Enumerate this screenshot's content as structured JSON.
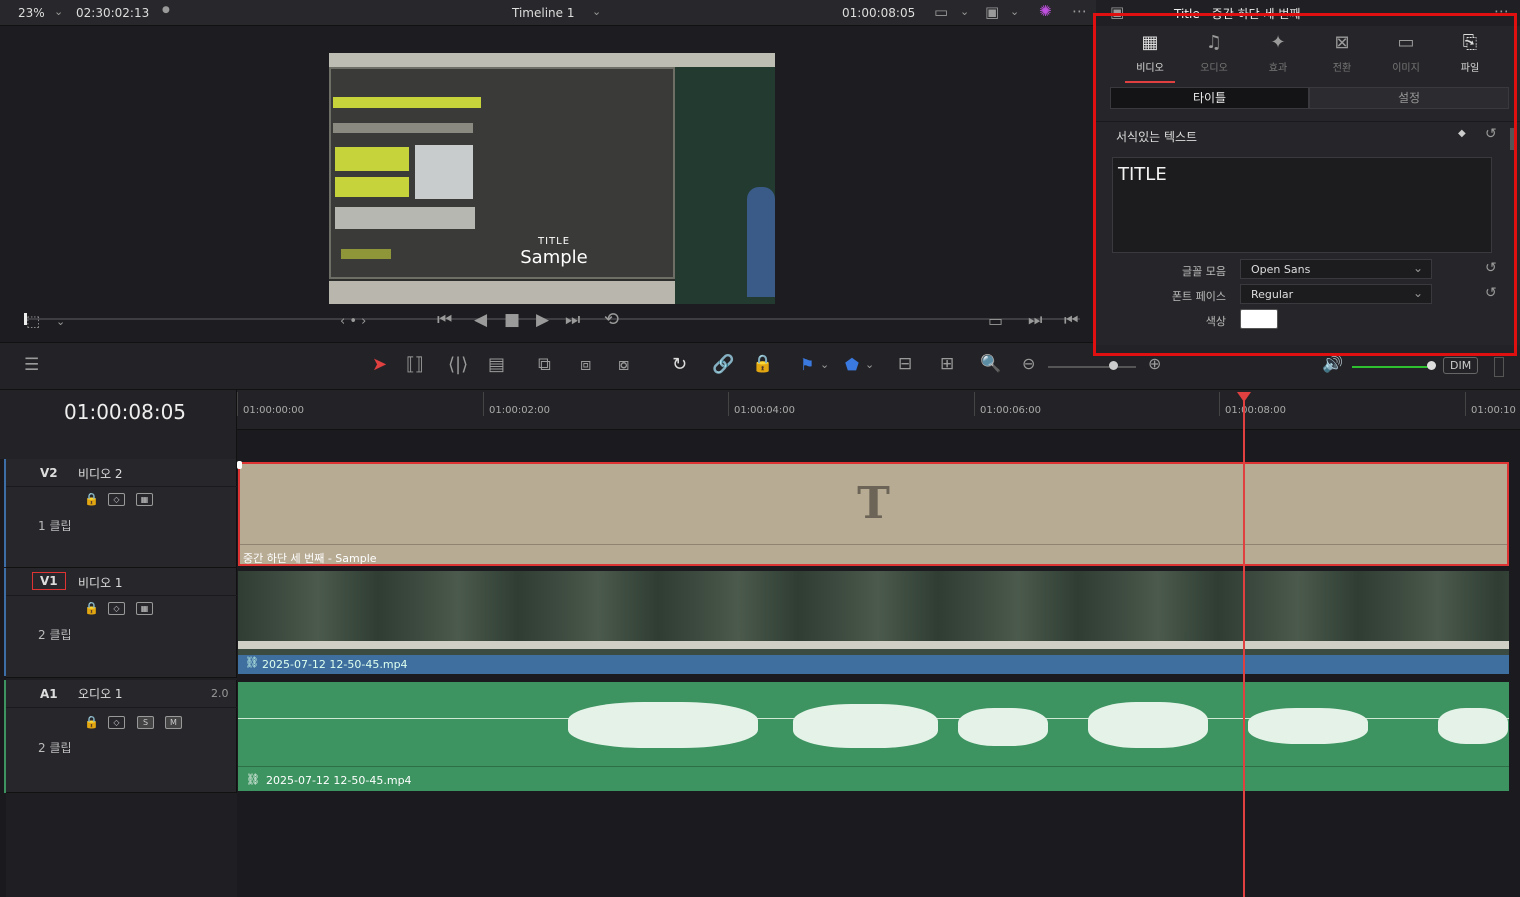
{
  "top": {
    "zoom": "23%",
    "source_timecode": "02:30:02:13",
    "timeline_name": "Timeline 1",
    "record_timecode": "01:00:08:05",
    "inspector_title": "Title - 중간 하단 세 번째"
  },
  "viewer": {
    "title_small": "TITLE",
    "title_large": "Sample"
  },
  "inspector": {
    "tabs": [
      {
        "label": "비디오",
        "icon": "film-icon"
      },
      {
        "label": "오디오",
        "icon": "music-note-icon"
      },
      {
        "label": "효과",
        "icon": "magic-wand-icon"
      },
      {
        "label": "전환",
        "icon": "transition-icon"
      },
      {
        "label": "이미지",
        "icon": "image-icon"
      },
      {
        "label": "파일",
        "icon": "file-icon"
      }
    ],
    "subtabs": [
      "타이틀",
      "설정"
    ],
    "section": "서식있는 텍스트",
    "text_value": "TITLE",
    "font_family_label": "글꼴 모음",
    "font_family_value": "Open Sans",
    "font_face_label": "폰트 페이스",
    "font_face_value": "Regular",
    "color_label": "색상",
    "color_value": "#ffffff"
  },
  "timeline": {
    "timecode": "01:00:08:05",
    "ruler": [
      "01:00:00:00",
      "01:00:02:00",
      "01:00:04:00",
      "01:00:06:00",
      "01:00:08:00",
      "01:00:10"
    ],
    "dim_label": "DIM",
    "tracks": [
      {
        "id": "V2",
        "name": "비디오 2",
        "clips": "1 클립",
        "clip_label": "중간 하단 세 번째 - Sample"
      },
      {
        "id": "V1",
        "name": "비디오 1",
        "clips": "2 클립",
        "clip_label": "2025-07-12 12-50-45.mp4"
      },
      {
        "id": "A1",
        "name": "오디오 1",
        "clips": "2 클립",
        "level": "2.0",
        "clip_label": "2025-07-12 12-50-45.mp4"
      }
    ]
  },
  "colors": {
    "accent": "#e04040",
    "title_clip": "#b7ab94",
    "video_clip": "#3f6f9f",
    "audio_clip": "#3d9461"
  }
}
